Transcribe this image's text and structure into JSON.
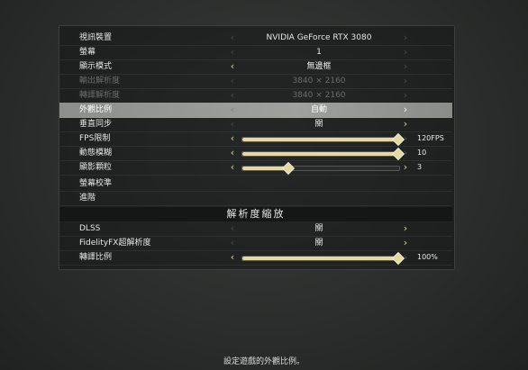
{
  "menu": {
    "rows": [
      {
        "label": "視訊裝置",
        "value": "NVIDIA GeForce RTX 3080"
      },
      {
        "label": "螢幕",
        "value": "1"
      },
      {
        "label": "顯示模式",
        "value": "無邊框"
      },
      {
        "label": "輸出解析度",
        "value": "3840 × 2160"
      },
      {
        "label": "轉譯解析度",
        "value": "3840 × 2160"
      },
      {
        "label": "外觀比例",
        "value": "自動"
      },
      {
        "label": "垂直同步",
        "value": "關"
      },
      {
        "label": "FPS限制",
        "value": "120FPS",
        "level": 1.0
      },
      {
        "label": "動態模糊",
        "value": "10",
        "level": 1.0
      },
      {
        "label": "顯影顆粒",
        "value": "3",
        "level": 0.3
      },
      {
        "label": "螢幕校準"
      },
      {
        "label": "進階"
      },
      {
        "label": "DLSS",
        "value": "關"
      },
      {
        "label": "FidelityFX超解析度",
        "value": "關"
      },
      {
        "label": "轉譯比例",
        "value": "100%",
        "level": 1.0
      }
    ],
    "section_title": "解析度縮放",
    "left_arrow": "‹",
    "right_arrow": "›"
  },
  "hint": "設定遊戲的外觀比例。",
  "colors": {
    "accent": "#e3d9a1",
    "selected": "#9a9c97",
    "background": "#2b2e2c"
  }
}
